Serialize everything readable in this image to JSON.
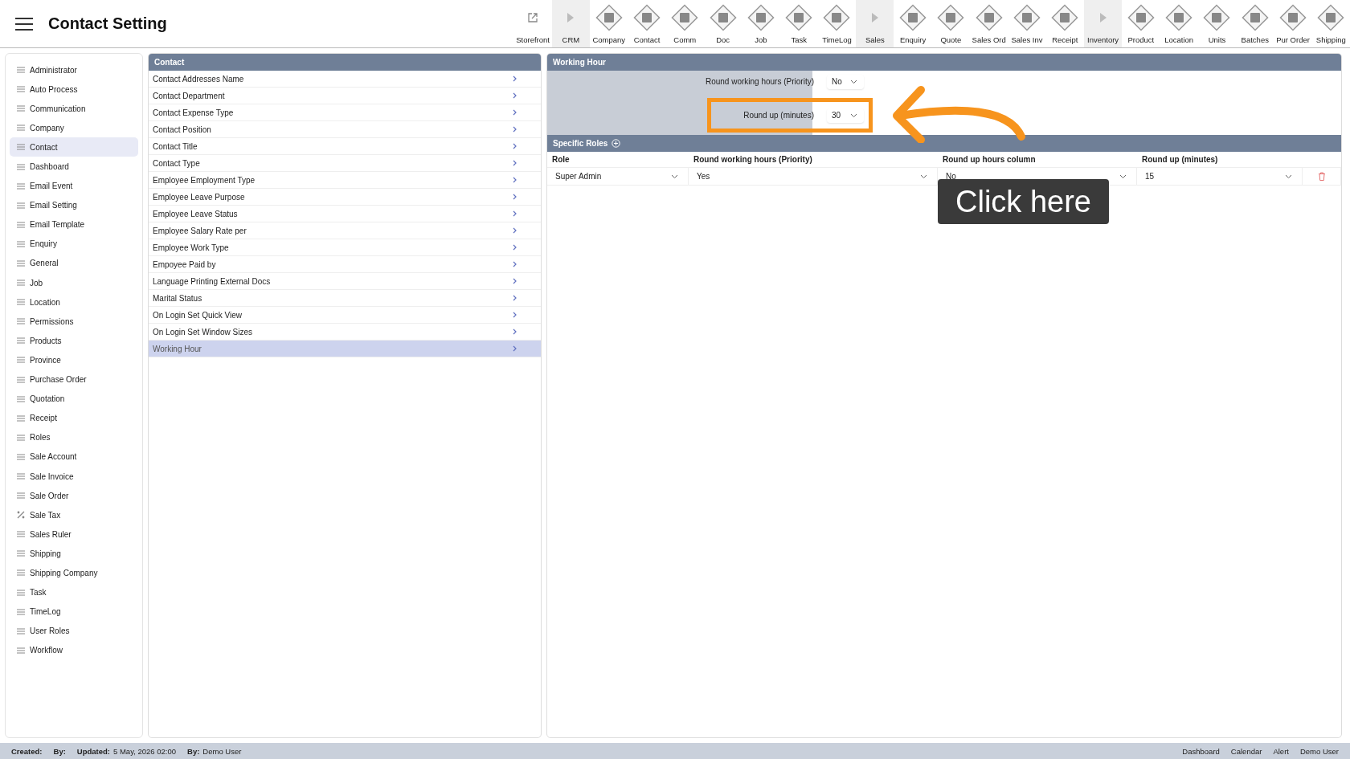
{
  "header": {
    "title": "Contact Setting"
  },
  "toolbar": [
    {
      "kind": "link",
      "label": "Storefront"
    },
    {
      "kind": "section",
      "label": "CRM"
    },
    {
      "kind": "module",
      "label": "Company"
    },
    {
      "kind": "module",
      "label": "Contact"
    },
    {
      "kind": "module",
      "label": "Comm"
    },
    {
      "kind": "module",
      "label": "Doc"
    },
    {
      "kind": "module",
      "label": "Job"
    },
    {
      "kind": "module",
      "label": "Task"
    },
    {
      "kind": "module",
      "label": "TimeLog"
    },
    {
      "kind": "section",
      "label": "Sales"
    },
    {
      "kind": "module",
      "label": "Enquiry"
    },
    {
      "kind": "module",
      "label": "Quote"
    },
    {
      "kind": "module",
      "label": "Sales Ord"
    },
    {
      "kind": "module",
      "label": "Sales Inv"
    },
    {
      "kind": "module",
      "label": "Receipt"
    },
    {
      "kind": "section",
      "label": "Inventory"
    },
    {
      "kind": "module",
      "label": "Product"
    },
    {
      "kind": "module",
      "label": "Location"
    },
    {
      "kind": "module",
      "label": "Units"
    },
    {
      "kind": "module",
      "label": "Batches"
    },
    {
      "kind": "module",
      "label": "Pur Order"
    },
    {
      "kind": "module",
      "label": "Shipping"
    }
  ],
  "sidebar": {
    "items": [
      {
        "kind": "list",
        "label": "Administrator",
        "selected": false
      },
      {
        "kind": "list",
        "label": "Auto Process",
        "selected": false
      },
      {
        "kind": "list",
        "label": "Communication",
        "selected": false
      },
      {
        "kind": "list",
        "label": "Company",
        "selected": false
      },
      {
        "kind": "list",
        "label": "Contact",
        "selected": true
      },
      {
        "kind": "list",
        "label": "Dashboard",
        "selected": false
      },
      {
        "kind": "list",
        "label": "Email Event",
        "selected": false
      },
      {
        "kind": "list",
        "label": "Email Setting",
        "selected": false
      },
      {
        "kind": "list",
        "label": "Email Template",
        "selected": false
      },
      {
        "kind": "list",
        "label": "Enquiry",
        "selected": false
      },
      {
        "kind": "list",
        "label": "General",
        "selected": false
      },
      {
        "kind": "list",
        "label": "Job",
        "selected": false
      },
      {
        "kind": "list",
        "label": "Location",
        "selected": false
      },
      {
        "kind": "list",
        "label": "Permissions",
        "selected": false
      },
      {
        "kind": "list",
        "label": "Products",
        "selected": false
      },
      {
        "kind": "list",
        "label": "Province",
        "selected": false
      },
      {
        "kind": "list",
        "label": "Purchase Order",
        "selected": false
      },
      {
        "kind": "list",
        "label": "Quotation",
        "selected": false
      },
      {
        "kind": "list",
        "label": "Receipt",
        "selected": false
      },
      {
        "kind": "list",
        "label": "Roles",
        "selected": false
      },
      {
        "kind": "list",
        "label": "Sale Account",
        "selected": false
      },
      {
        "kind": "list",
        "label": "Sale Invoice",
        "selected": false
      },
      {
        "kind": "list",
        "label": "Sale Order",
        "selected": false
      },
      {
        "kind": "percent",
        "label": "Sale Tax",
        "selected": false
      },
      {
        "kind": "list",
        "label": "Sales Ruler",
        "selected": false
      },
      {
        "kind": "list",
        "label": "Shipping",
        "selected": false
      },
      {
        "kind": "list",
        "label": "Shipping Company",
        "selected": false
      },
      {
        "kind": "list",
        "label": "Task",
        "selected": false
      },
      {
        "kind": "list",
        "label": "TimeLog",
        "selected": false
      },
      {
        "kind": "list",
        "label": "User Roles",
        "selected": false
      },
      {
        "kind": "list",
        "label": "Workflow",
        "selected": false
      }
    ]
  },
  "list": {
    "title": "Contact",
    "items": [
      {
        "label": "Contact Addresses Name",
        "selected": false
      },
      {
        "label": "Contact Department",
        "selected": false
      },
      {
        "label": "Contact Expense Type",
        "selected": false
      },
      {
        "label": "Contact Position",
        "selected": false
      },
      {
        "label": "Contact Title",
        "selected": false
      },
      {
        "label": "Contact Type",
        "selected": false
      },
      {
        "label": "Employee Employment Type",
        "selected": false
      },
      {
        "label": "Employee Leave Purpose",
        "selected": false
      },
      {
        "label": "Employee Leave Status",
        "selected": false
      },
      {
        "label": "Employee Salary Rate per",
        "selected": false
      },
      {
        "label": "Employee Work Type",
        "selected": false
      },
      {
        "label": "Empoyee Paid by",
        "selected": false
      },
      {
        "label": "Language Printing External Docs",
        "selected": false
      },
      {
        "label": "Marital Status",
        "selected": false
      },
      {
        "label": "On Login Set Quick View",
        "selected": false
      },
      {
        "label": "On Login Set Window Sizes",
        "selected": false
      },
      {
        "label": "Working Hour",
        "selected": true
      }
    ]
  },
  "working_hour": {
    "title": "Working Hour",
    "fields": [
      {
        "label": "Round working hours (Priority)",
        "value": "No",
        "highlighted": false
      },
      {
        "label": "Round up (minutes)",
        "value": "30",
        "highlighted": true
      }
    ]
  },
  "specific_roles": {
    "title": "Specific Roles",
    "columns": [
      "Role",
      "Round working hours (Priority)",
      "Round up hours column",
      "Round up (minutes)"
    ],
    "rows": [
      {
        "cells": [
          "Super Admin",
          "Yes",
          "No",
          "15"
        ]
      }
    ]
  },
  "callout": {
    "text": "Click here"
  },
  "status_bar": {
    "left": [
      {
        "label": "Created:"
      },
      {
        "label": "By:"
      },
      {
        "label": "Updated:",
        "value": "5 May, 2026  02:00"
      },
      {
        "label": "By:",
        "value": "Demo User"
      }
    ],
    "right": [
      "Dashboard",
      "Calendar",
      "Alert",
      "Demo User"
    ]
  }
}
